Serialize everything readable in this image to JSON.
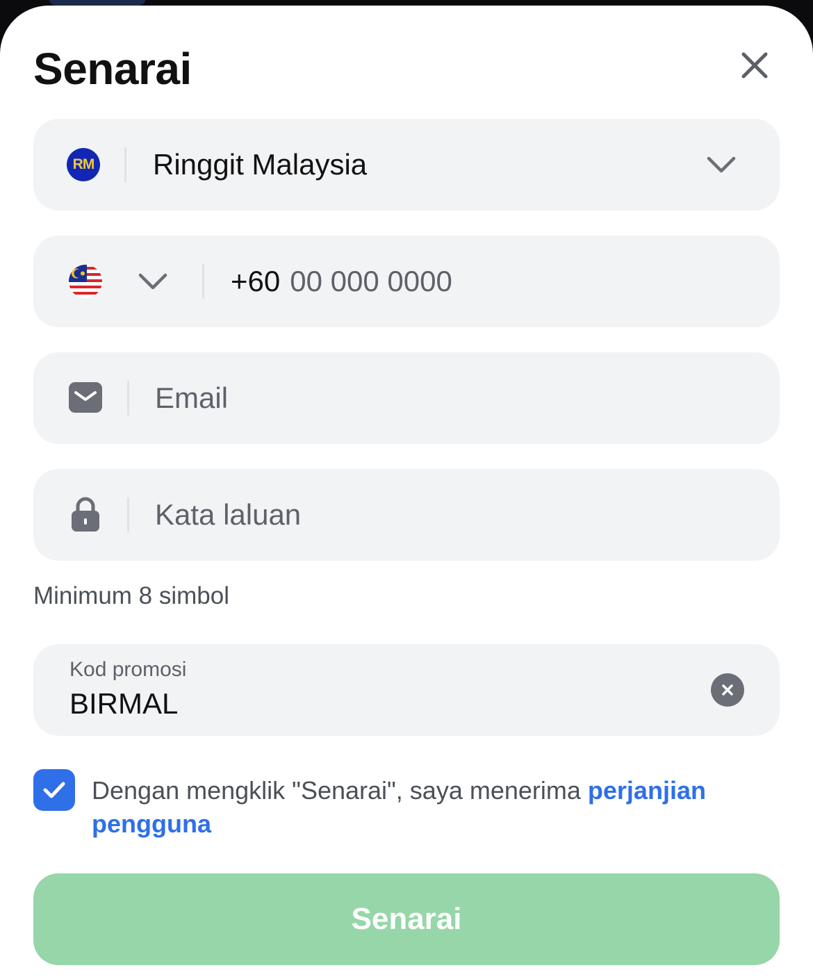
{
  "header": {
    "title": "Senarai"
  },
  "currency": {
    "badge": "RM",
    "label": "Ringgit Malaysia"
  },
  "phone": {
    "prefix": "+60",
    "placeholder": "00 000 0000"
  },
  "email": {
    "placeholder": "Email"
  },
  "password": {
    "placeholder": "Kata laluan",
    "hint": "Minimum 8 simbol"
  },
  "promo": {
    "label": "Kod promosi",
    "value": "BIRMAL"
  },
  "agreement": {
    "checked": true,
    "text": "Dengan mengklik \"Senarai\", saya menerima ",
    "link": "perjanjian pengguna"
  },
  "submit": {
    "label": "Senarai"
  },
  "colors": {
    "accent": "#2f6fe8",
    "submit_disabled": "#96d6a8",
    "field_bg": "#f2f3f5"
  }
}
